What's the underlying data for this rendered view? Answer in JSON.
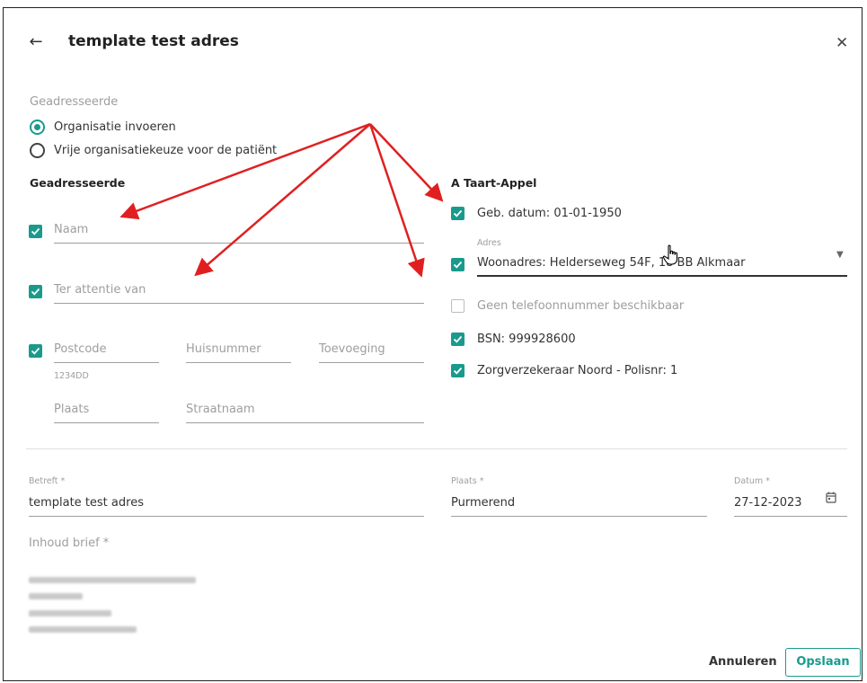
{
  "dialog": {
    "title": "template test adres",
    "back_icon": "arrow-left-icon",
    "close_icon": "close-icon"
  },
  "addressee_type": {
    "label": "Geadresseerde",
    "options": [
      "Organisatie invoeren",
      "Vrije organisatiekeuze voor de patiënt"
    ],
    "selected": 0
  },
  "left": {
    "heading": "Geadresseerde",
    "naam_placeholder": "Naam",
    "ter_attentie_placeholder": "Ter attentie van",
    "postcode_placeholder": "Postcode",
    "postcode_hint": "1234DD",
    "huisnummer_placeholder": "Huisnummer",
    "toevoeging_placeholder": "Toevoeging",
    "plaats_placeholder": "Plaats",
    "straatnaam_placeholder": "Straatnaam"
  },
  "right": {
    "heading": "A Taart-Appel",
    "geb_datum": "Geb. datum: 01-01-1950",
    "adres_label": "Adres",
    "adres_value": "Woonadres: Helderseweg 54F, 18  BB Alkmaar",
    "telefoon": "Geen telefoonnummer beschikbaar",
    "bsn": "BSN: 999928600",
    "zorgverzekeraar": "Zorgverzekeraar Noord - Polisnr: 1"
  },
  "bottom": {
    "betreft_label": "Betreft *",
    "betreft_value": "template test adres",
    "plaats_label": "Plaats *",
    "plaats_value": "Purmerend",
    "datum_label": "Datum *",
    "datum_value": "27-12-2023",
    "calendar_icon": "calendar-icon",
    "inhoud_label": "Inhoud brief *"
  },
  "actions": {
    "cancel": "Annuleren",
    "save": "Opslaan"
  },
  "colors": {
    "accent": "#1a9a8c",
    "annotation_arrow": "#e02020"
  }
}
